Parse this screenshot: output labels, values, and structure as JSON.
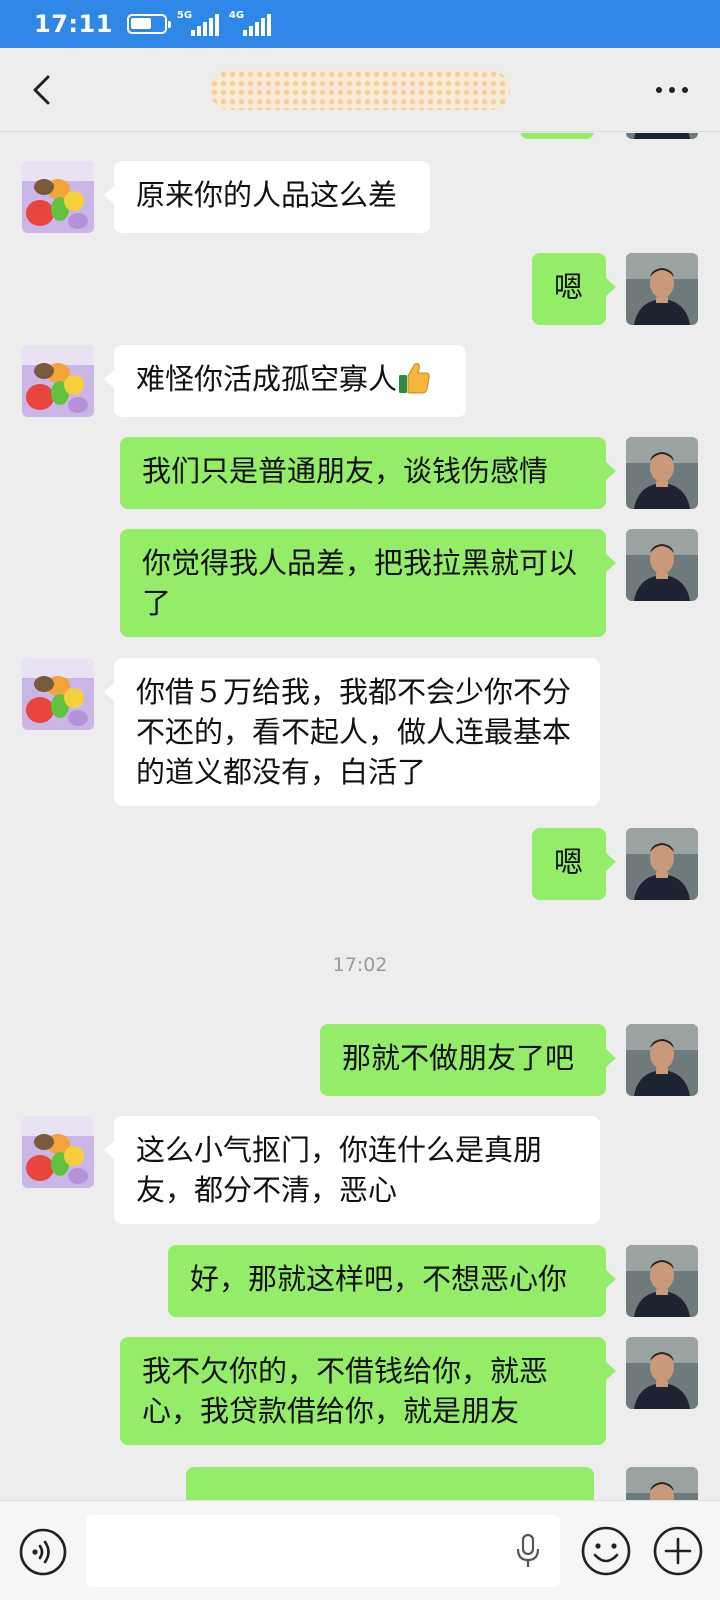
{
  "status_bar": {
    "time": "17:11",
    "net1": "5G",
    "net2": "4G"
  },
  "header": {
    "title": "",
    "back_icon": "chevron-left-icon",
    "more_icon": "more-horizontal-icon"
  },
  "messages": [
    {
      "side": "in",
      "text": "原来你的人品这么差"
    },
    {
      "side": "out",
      "text": "嗯"
    },
    {
      "side": "in",
      "text": "难怪你活成孤空寡人",
      "emoji": "thumbs-up"
    },
    {
      "side": "out",
      "text": "我们只是普通朋友，谈钱伤感情"
    },
    {
      "side": "out",
      "text": "你觉得我人品差，把我拉黑就可以了"
    },
    {
      "side": "in",
      "text": "你借５万给我，我都不会少你不分不还的，看不起人，做人连最基本的道义都没有，白活了"
    },
    {
      "side": "out",
      "text": "嗯"
    },
    {
      "side": "time",
      "text": "17:02"
    },
    {
      "side": "out",
      "text": "那就不做朋友了吧"
    },
    {
      "side": "in",
      "text": "这么小气抠门，你连什么是真朋友，都分不清，恶心"
    },
    {
      "side": "out",
      "text": "好，那就这样吧，不想恶心你"
    },
    {
      "side": "out",
      "text": "我不欠你的，不借钱给你，就恶心，我贷款借给你，就是朋友"
    }
  ],
  "colors": {
    "status_bar": "#2f87e8",
    "chat_background": "#ededed",
    "outgoing_bubble": "#95ec69",
    "incoming_bubble": "#ffffff"
  },
  "input_bar": {
    "voice_icon": "voice-icon",
    "mic_icon": "microphone-icon",
    "emoji_icon": "emoji-icon",
    "plus_icon": "plus-icon",
    "value": ""
  }
}
